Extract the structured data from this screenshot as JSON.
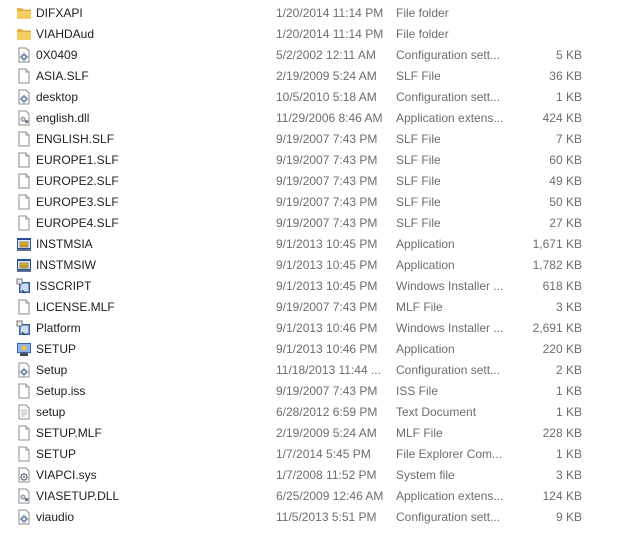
{
  "files": [
    {
      "name": "DIFXAPI",
      "date": "1/20/2014 11:14 PM",
      "type": "File folder",
      "size": "",
      "icon": "folder"
    },
    {
      "name": "VIAHDAud",
      "date": "1/20/2014 11:14 PM",
      "type": "File folder",
      "size": "",
      "icon": "folder"
    },
    {
      "name": "0X0409",
      "date": "5/2/2002 12:11 AM",
      "type": "Configuration sett...",
      "size": "5 KB",
      "icon": "config"
    },
    {
      "name": "ASIA.SLF",
      "date": "2/19/2009 5:24 AM",
      "type": "SLF File",
      "size": "36 KB",
      "icon": "file"
    },
    {
      "name": "desktop",
      "date": "10/5/2010 5:18 AM",
      "type": "Configuration sett...",
      "size": "1 KB",
      "icon": "config"
    },
    {
      "name": "english.dll",
      "date": "11/29/2006 8:46 AM",
      "type": "Application extens...",
      "size": "424 KB",
      "icon": "dll"
    },
    {
      "name": "ENGLISH.SLF",
      "date": "9/19/2007 7:43 PM",
      "type": "SLF File",
      "size": "7 KB",
      "icon": "file"
    },
    {
      "name": "EUROPE1.SLF",
      "date": "9/19/2007 7:43 PM",
      "type": "SLF File",
      "size": "60 KB",
      "icon": "file"
    },
    {
      "name": "EUROPE2.SLF",
      "date": "9/19/2007 7:43 PM",
      "type": "SLF File",
      "size": "49 KB",
      "icon": "file"
    },
    {
      "name": "EUROPE3.SLF",
      "date": "9/19/2007 7:43 PM",
      "type": "SLF File",
      "size": "50 KB",
      "icon": "file"
    },
    {
      "name": "EUROPE4.SLF",
      "date": "9/19/2007 7:43 PM",
      "type": "SLF File",
      "size": "27 KB",
      "icon": "file"
    },
    {
      "name": "INSTMSIA",
      "date": "9/1/2013 10:45 PM",
      "type": "Application",
      "size": "1,671 KB",
      "icon": "app"
    },
    {
      "name": "INSTMSIW",
      "date": "9/1/2013 10:45 PM",
      "type": "Application",
      "size": "1,782 KB",
      "icon": "app"
    },
    {
      "name": "ISSCRIPT",
      "date": "9/1/2013 10:45 PM",
      "type": "Windows Installer ...",
      "size": "618 KB",
      "icon": "installer"
    },
    {
      "name": "LICENSE.MLF",
      "date": "9/19/2007 7:43 PM",
      "type": "MLF File",
      "size": "3 KB",
      "icon": "file"
    },
    {
      "name": "Platform",
      "date": "9/1/2013 10:46 PM",
      "type": "Windows Installer ...",
      "size": "2,691 KB",
      "icon": "installer"
    },
    {
      "name": "SETUP",
      "date": "9/1/2013 10:46 PM",
      "type": "Application",
      "size": "220 KB",
      "icon": "setup"
    },
    {
      "name": "Setup",
      "date": "11/18/2013 11:44 ...",
      "type": "Configuration sett...",
      "size": "2 KB",
      "icon": "config"
    },
    {
      "name": "Setup.iss",
      "date": "9/19/2007 7:43 PM",
      "type": "ISS File",
      "size": "1 KB",
      "icon": "file"
    },
    {
      "name": "setup",
      "date": "6/28/2012 6:59 PM",
      "type": "Text Document",
      "size": "1 KB",
      "icon": "text"
    },
    {
      "name": "SETUP.MLF",
      "date": "2/19/2009 5:24 AM",
      "type": "MLF File",
      "size": "228 KB",
      "icon": "file"
    },
    {
      "name": "SETUP",
      "date": "1/7/2014 5:45 PM",
      "type": "File Explorer Com...",
      "size": "1 KB",
      "icon": "file"
    },
    {
      "name": "VIAPCI.sys",
      "date": "1/7/2008 11:52 PM",
      "type": "System file",
      "size": "3 KB",
      "icon": "sys"
    },
    {
      "name": "VIASETUP.DLL",
      "date": "6/25/2009 12:46 AM",
      "type": "Application extens...",
      "size": "124 KB",
      "icon": "dll"
    },
    {
      "name": "viaudio",
      "date": "11/5/2013 5:51 PM",
      "type": "Configuration sett...",
      "size": "9 KB",
      "icon": "config"
    }
  ]
}
